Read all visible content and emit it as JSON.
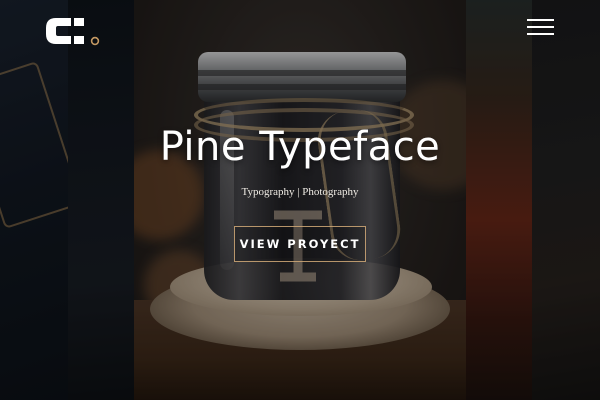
{
  "header": {
    "logo_icon": "brand-c-logo-icon",
    "menu_icon": "hamburger-menu-icon",
    "accent_color": "#c59a63"
  },
  "hero": {
    "title": "Pine Typeface",
    "subtitle": "Typography | Photography",
    "button_label": "VIEW PROYECT",
    "button_border_color": "#d2aa78"
  },
  "colors": {
    "text": "#ffffff",
    "background": "#0b0b0c"
  }
}
